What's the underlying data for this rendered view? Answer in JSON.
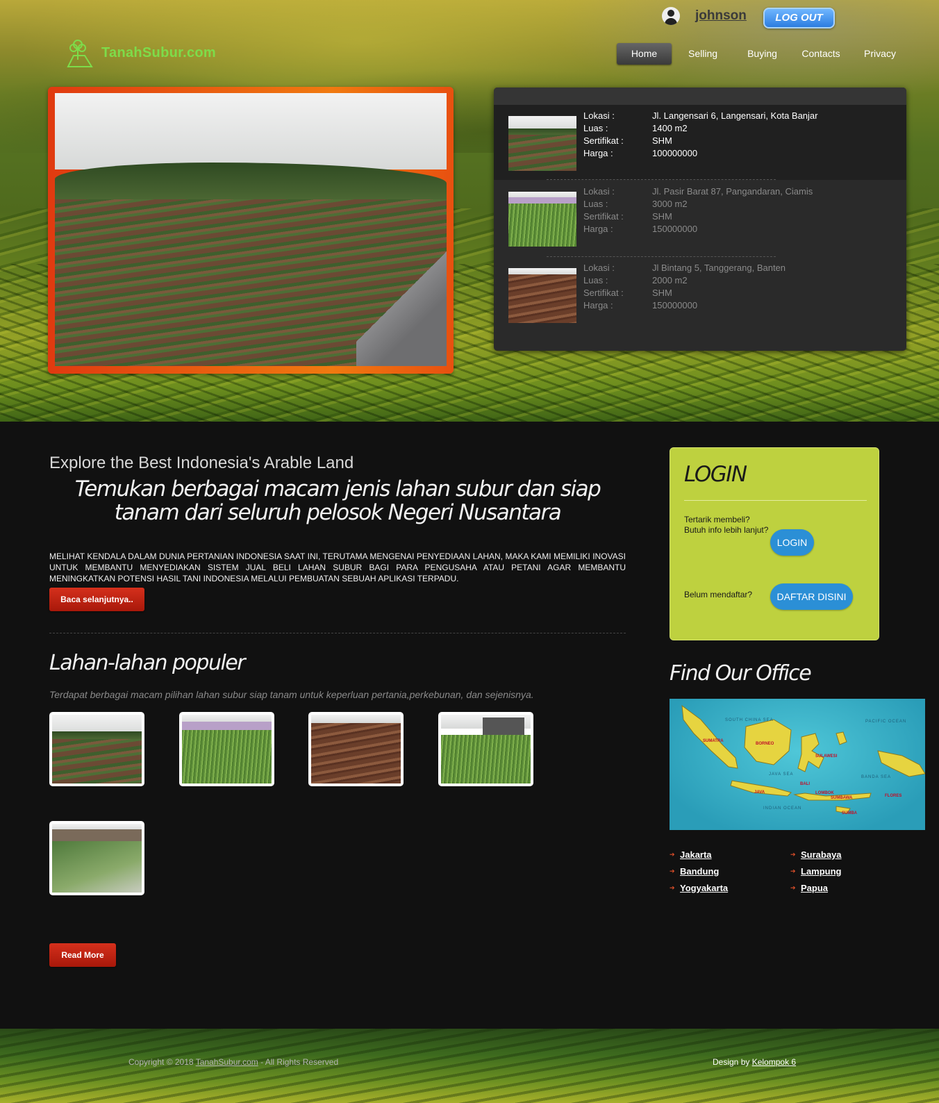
{
  "user": {
    "name": "johnson",
    "logout_label": "LOG OUT"
  },
  "brand": {
    "name": "TanahSubur.com",
    "color": "#7ddc4a"
  },
  "nav": [
    {
      "label": "Home",
      "active": true
    },
    {
      "label": "Selling",
      "active": false
    },
    {
      "label": "Buying",
      "active": false
    },
    {
      "label": "Contacts",
      "active": false
    },
    {
      "label": "Privacy",
      "active": false
    }
  ],
  "listings": [
    {
      "lokasi_label": "Lokasi :",
      "lokasi": "Jl. Langensari 6, Langensari, Kota Banjar",
      "luas_label": "Luas :",
      "luas": "1400 m2",
      "sertifikat_label": "Sertifikat :",
      "sertifikat": "SHM",
      "harga_label": "Harga :",
      "harga": "100000000"
    },
    {
      "lokasi_label": "Lokasi :",
      "lokasi": "Jl. Pasir Barat 87, Pangandaran, Ciamis",
      "luas_label": "Luas :",
      "luas": "3000 m2",
      "sertifikat_label": "Sertifikat :",
      "sertifikat": "SHM",
      "harga_label": "Harga :",
      "harga": "150000000"
    },
    {
      "lokasi_label": "Lokasi :",
      "lokasi": "Jl Bintang 5, Tanggerang, Banten",
      "luas_label": "Luas :",
      "luas": "2000 m2",
      "sertifikat_label": "Sertifikat :",
      "sertifikat": "SHM",
      "harga_label": "Harga :",
      "harga": "150000000"
    }
  ],
  "main": {
    "explore_title": "Explore the Best Indonesia's Arable Land",
    "tagline": "Temukan berbagai macam jenis lahan subur dan siap tanam dari seluruh pelosok Negeri Nusantara",
    "intro": "MELIHAT KENDALA DALAM DUNIA PERTANIAN INDONESIA SAAT INI, TERUTAMA MENGENAI PENYEDIAAN LAHAN, MAKA KAMI MEMILIKI INOVASI UNTUK MEMBANTU MENYEDIAKAN SISTEM JUAL BELI LAHAN SUBUR BAGI PARA PENGUSAHA ATAU PETANI AGAR MEMBANTU MENINGKATKAN POTENSI HASIL TANI INDONESIA MELALUI PEMBUATAN SEBUAH APLIKASI TERPADU.",
    "read_more_intro": "Baca selanjutnya..",
    "popular_title": "Lahan-lahan populer",
    "popular_desc": "Terdapat berbagai macam pilihan lahan subur siap tanam untuk keperluan pertania,perkebunan, dan sejenisnya.",
    "read_more": "Read More"
  },
  "login": {
    "title": "LOGIN",
    "prompt_line1": "Tertarik membeli?",
    "prompt_line2": "Butuh info lebih lanjut?",
    "login_button": "LOGIN",
    "register_prompt": "Belum mendaftar?",
    "register_button": "DAFTAR DISINI"
  },
  "office": {
    "title": "Find Our Office",
    "map_labels": {
      "south_china_sea": "SOUTH CHINA SEA",
      "pacific_ocean": "PACIFIC OCEAN",
      "indian_ocean": "INDIAN OCEAN",
      "java_sea": "JAVA SEA",
      "banda_sea": "BANDA SEA",
      "sumatra": "SUMATRA",
      "borneo": "BORNEO",
      "sulawesi": "SULAWESI",
      "java": "JAVA",
      "bali": "BALI",
      "lombok": "LOMBOK",
      "sumbawa": "SUMBAWA",
      "flores": "FLORES",
      "sumba": "SUMBA"
    },
    "cities": [
      "Jakarta",
      "Surabaya",
      "Bandung",
      "Lampung",
      "Yogyakarta",
      "Papua"
    ]
  },
  "footer": {
    "copyright_prefix": "Copyright © 2018 ",
    "copyright_link": "TanahSubur.com",
    "copyright_suffix": " - All Rights Reserved",
    "design_prefix": "Design by ",
    "design_link": "Kelompok 6"
  }
}
